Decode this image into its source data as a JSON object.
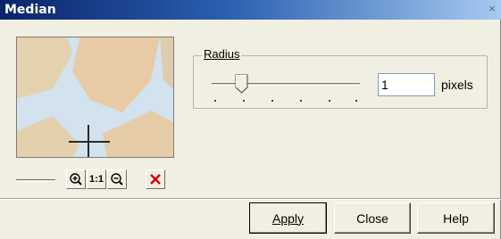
{
  "window": {
    "title": "Median",
    "close_glyph": "×"
  },
  "preview": {
    "zoom_in_icon": "zoom-in-icon",
    "actual_size_icon": "actual-size-icon",
    "zoom_out_icon": "zoom-out-icon",
    "reset_icon": "red-x-icon",
    "actual_size_label": "1:1"
  },
  "radius": {
    "group_label": "Radius",
    "value": "1",
    "unit": "pixels",
    "slider_fraction": 0.2
  },
  "buttons": {
    "apply": "Apply",
    "close": "Close",
    "help": "Help"
  },
  "colors": {
    "title_bar": "#0a246a",
    "dialog_bg": "#f1efe2",
    "reset_red": "#cc0000"
  }
}
